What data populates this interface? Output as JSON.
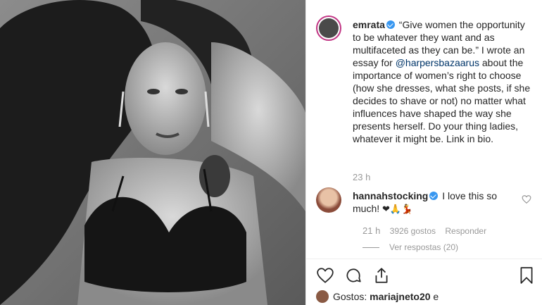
{
  "post": {
    "author": "emrata",
    "caption": " “Give women the opportunity to be whatever they want and as multifaceted as they can be.” I wrote an essay for ",
    "mention": "@harpersbazaarus",
    "caption_end": " about the importance of women’s right to choose (how she dresses, what she posts, if she decides to shave or not) no matter what influences have shaped the way she presents herself. Do your thing ladies, whatever it might be. Link in bio.",
    "time": "23 h"
  },
  "comment": {
    "author": "hannahstocking",
    "text": " I love this so much! ",
    "emojis": "❤🙏💃",
    "time": "21 h",
    "likes": "3926 gostos",
    "reply_label": "Responder",
    "view_replies": "Ver respostas (20)"
  },
  "likes": {
    "prefix": "Gostos: ",
    "user": "mariajneto20",
    "suffix": " e"
  },
  "icons": [
    "heart-icon",
    "comment-icon",
    "share-icon",
    "bookmark-icon"
  ],
  "colors": {
    "verified": "#3897f0",
    "mention": "#003569",
    "muted": "#999999"
  }
}
